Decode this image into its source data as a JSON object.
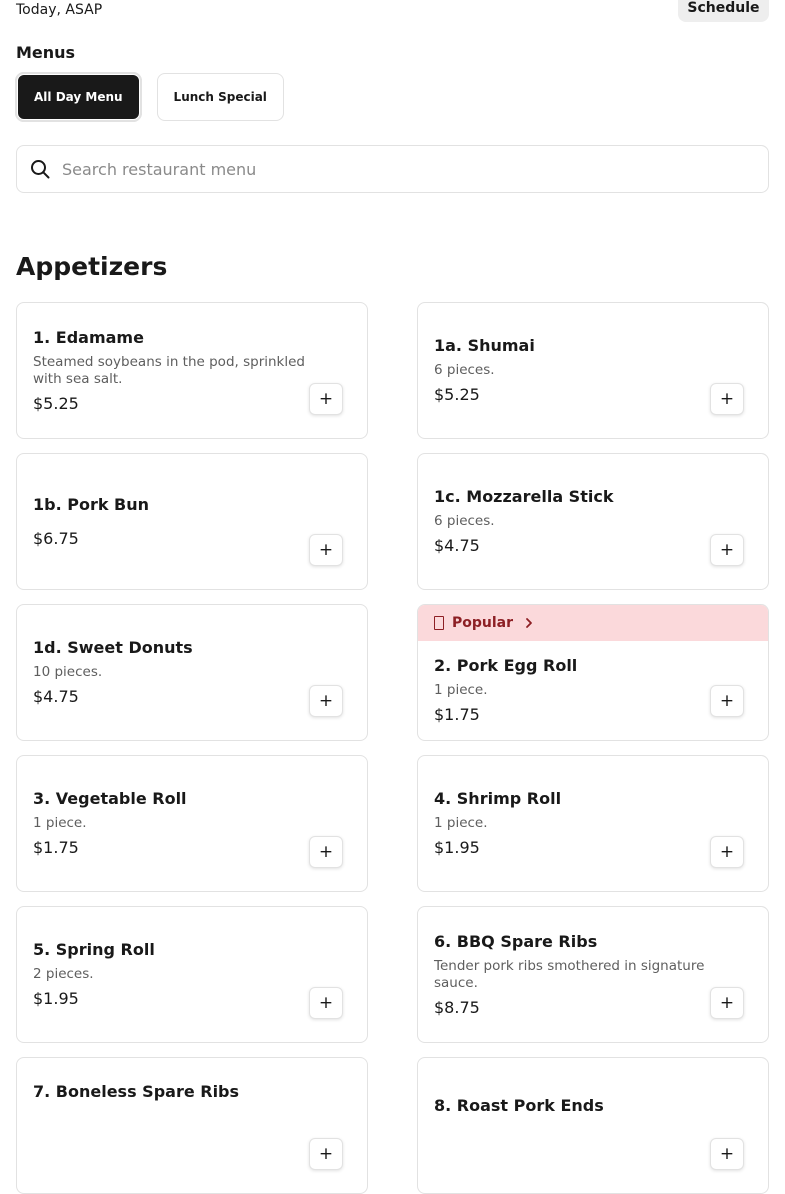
{
  "header": {
    "delivery_time": "Today, ASAP",
    "schedule_label": "Schedule"
  },
  "menus": {
    "title": "Menus",
    "tabs": [
      {
        "label": "All Day Menu",
        "active": true
      },
      {
        "label": "Lunch Special",
        "active": false
      }
    ]
  },
  "search": {
    "placeholder": "Search restaurant menu",
    "value": ""
  },
  "section": {
    "title": "Appetizers"
  },
  "items": [
    {
      "name": "1. Edamame",
      "desc": "Steamed soybeans in the pod, sprinkled with sea salt.",
      "price": "$5.25",
      "add": "+"
    },
    {
      "name": "1a. Shumai",
      "desc": "6 pieces.",
      "price": "$5.25",
      "add": "+"
    },
    {
      "name": "1b. Pork Bun",
      "desc": "",
      "price": "$6.75",
      "add": "+"
    },
    {
      "name": "1c. Mozzarella Stick",
      "desc": "6 pieces.",
      "price": "$4.75",
      "add": "+"
    },
    {
      "name": "1d. Sweet Donuts",
      "desc": "10 pieces.",
      "price": "$4.75",
      "add": "+"
    },
    {
      "name": "2. Pork Egg Roll",
      "desc": "1 piece.",
      "price": "$1.75",
      "add": "+",
      "badge": "Popular"
    },
    {
      "name": "3. Vegetable Roll",
      "desc": "1 piece.",
      "price": "$1.75",
      "add": "+"
    },
    {
      "name": "4. Shrimp Roll",
      "desc": "1 piece.",
      "price": "$1.95",
      "add": "+"
    },
    {
      "name": "5. Spring Roll",
      "desc": "2 pieces.",
      "price": "$1.95",
      "add": "+"
    },
    {
      "name": "6. BBQ Spare Ribs",
      "desc": "Tender pork ribs smothered in signature sauce.",
      "price": "$8.75",
      "add": "+"
    },
    {
      "name": "7. Boneless Spare Ribs",
      "desc": "",
      "price": "",
      "add": "+"
    },
    {
      "name": "8. Roast Pork Ends",
      "desc": "",
      "price": "",
      "add": "+"
    }
  ],
  "colors": {
    "text": "#191919",
    "muted": "#5e5e5e",
    "border": "#e2e2e2",
    "active_tab_bg": "#191919",
    "popular_bg": "#fbd9db",
    "popular_text": "#8d1f24"
  },
  "icons": {
    "search": "search-icon",
    "badge": "popular-icon",
    "chevron": "chevron-right-icon",
    "add": "plus-icon"
  }
}
